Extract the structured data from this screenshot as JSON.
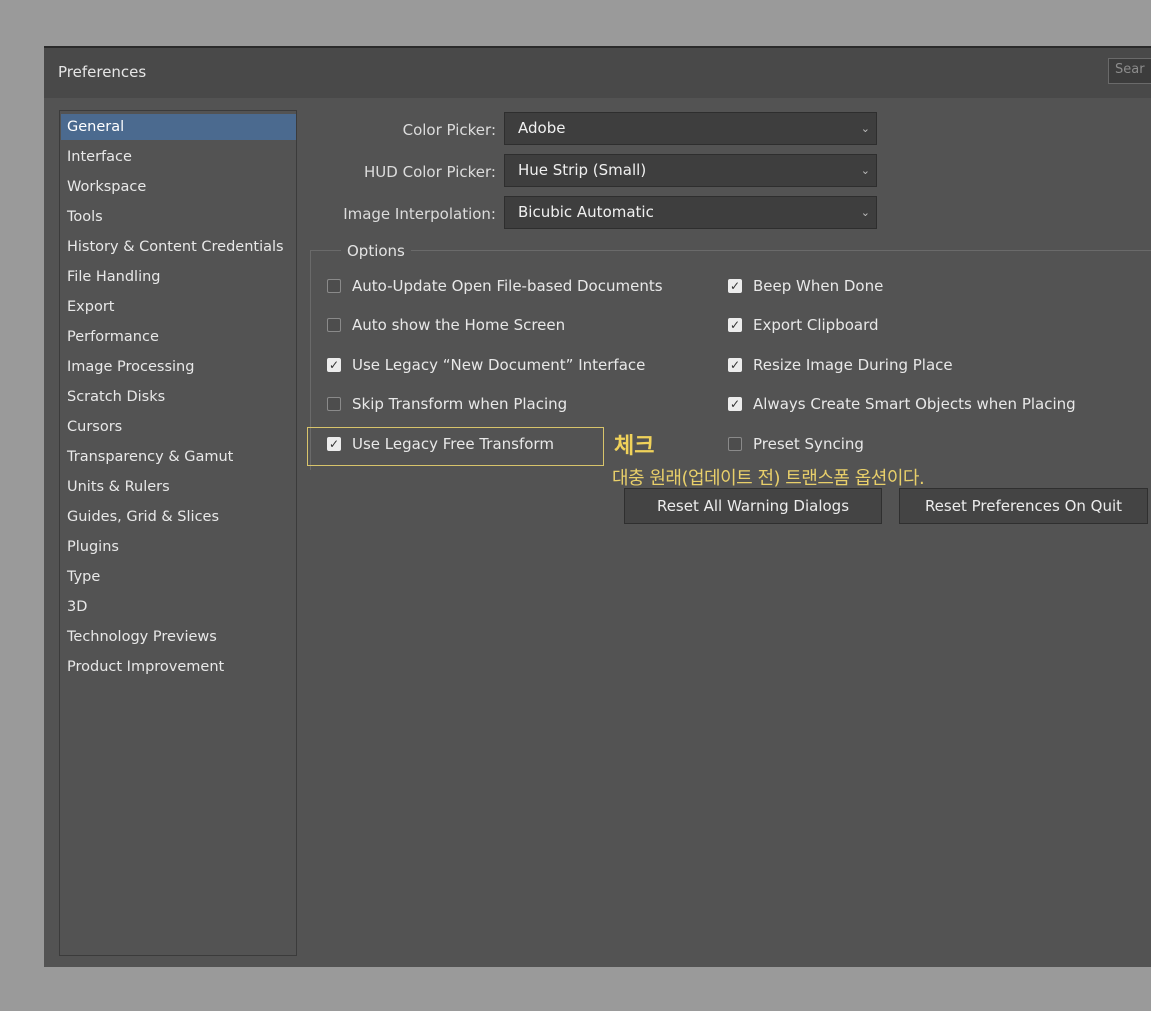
{
  "window": {
    "title": "Preferences",
    "search_placeholder": "Sear"
  },
  "sidebar": {
    "items": [
      {
        "label": "General",
        "selected": true
      },
      {
        "label": "Interface"
      },
      {
        "label": "Workspace"
      },
      {
        "label": "Tools"
      },
      {
        "label": "History & Content Credentials"
      },
      {
        "label": "File Handling"
      },
      {
        "label": "Export"
      },
      {
        "label": "Performance"
      },
      {
        "label": "Image Processing"
      },
      {
        "label": "Scratch Disks"
      },
      {
        "label": "Cursors"
      },
      {
        "label": "Transparency & Gamut"
      },
      {
        "label": "Units & Rulers"
      },
      {
        "label": "Guides, Grid & Slices"
      },
      {
        "label": "Plugins"
      },
      {
        "label": "Type"
      },
      {
        "label": "3D"
      },
      {
        "label": "Technology Previews"
      },
      {
        "label": "Product Improvement"
      }
    ]
  },
  "fields": {
    "color_picker": {
      "label": "Color Picker:",
      "value": "Adobe"
    },
    "hud_color_picker": {
      "label": "HUD Color Picker:",
      "value": "Hue Strip (Small)"
    },
    "image_interpolation": {
      "label": "Image Interpolation:",
      "value": "Bicubic Automatic"
    }
  },
  "options": {
    "legend": "Options",
    "left": [
      {
        "label": "Auto-Update Open File-based Documents",
        "checked": false
      },
      {
        "label": "Auto show the Home Screen",
        "checked": false
      },
      {
        "label": "Use Legacy “New Document” Interface",
        "checked": true
      },
      {
        "label": "Skip Transform when Placing",
        "checked": false
      },
      {
        "label": "Use Legacy Free Transform",
        "checked": true
      }
    ],
    "right": [
      {
        "label": "Beep When Done",
        "checked": true
      },
      {
        "label": "Export Clipboard",
        "checked": true
      },
      {
        "label": "Resize Image During Place",
        "checked": true
      },
      {
        "label": "Always Create Smart Objects when Placing",
        "checked": true
      },
      {
        "label": "Preset Syncing",
        "checked": false
      }
    ]
  },
  "annotation": {
    "title": "체크",
    "note": "대충 원래(업데이트 전) 트랜스폼 옵션이다.",
    "color": "#f0d25a"
  },
  "buttons": {
    "reset_warnings": "Reset All Warning Dialogs",
    "reset_prefs": "Reset Preferences On Quit"
  },
  "colors": {
    "selection": "#4b6a8f",
    "panel": "#535353",
    "highlight_border": "#d8c46b"
  }
}
